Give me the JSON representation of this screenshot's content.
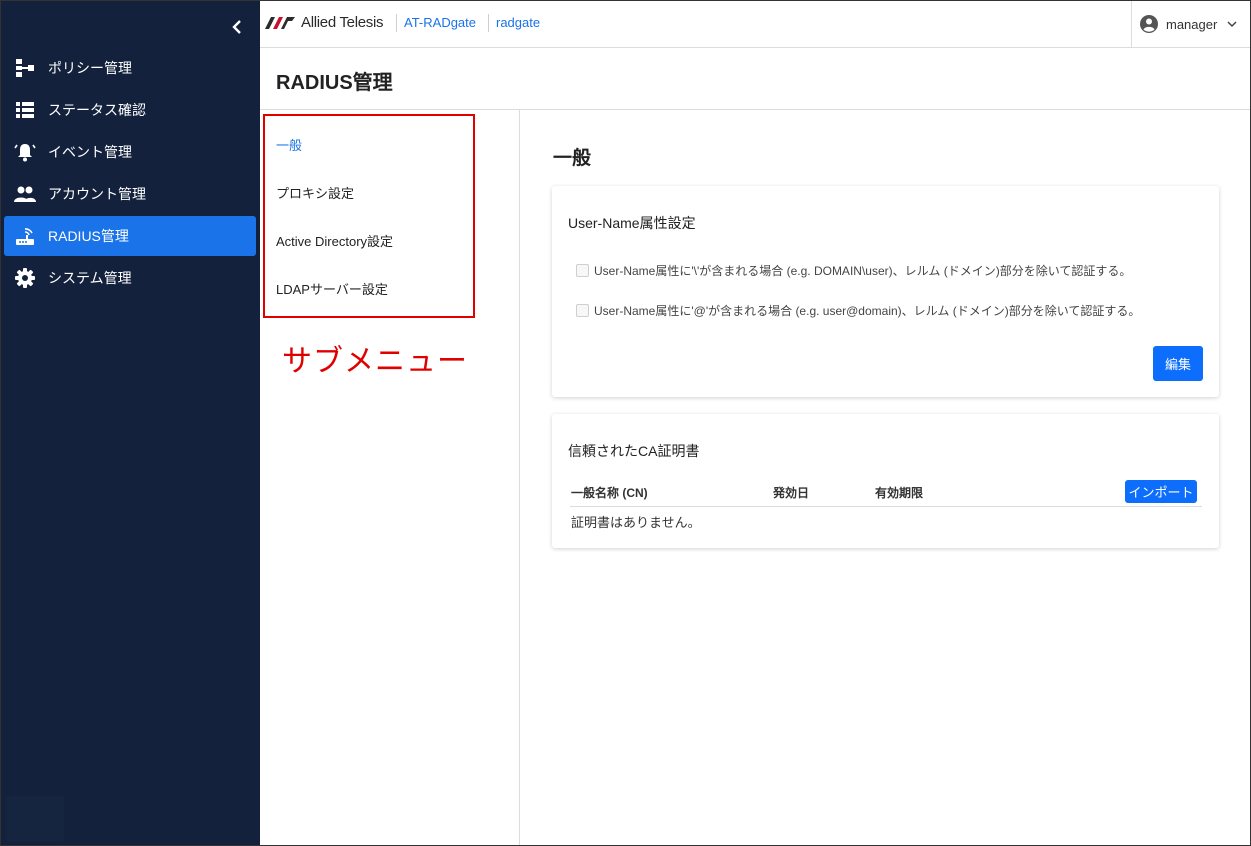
{
  "sidebar": {
    "items": [
      {
        "label": "ポリシー管理",
        "icon": "policy-tree-icon",
        "active": false
      },
      {
        "label": "ステータス確認",
        "icon": "list-icon",
        "active": false
      },
      {
        "label": "イベント管理",
        "icon": "alarm-bell-icon",
        "active": false
      },
      {
        "label": "アカウント管理",
        "icon": "people-icon",
        "active": false
      },
      {
        "label": "RADIUS管理",
        "icon": "router-icon",
        "active": true
      },
      {
        "label": "システム管理",
        "icon": "gear-icon",
        "active": false
      }
    ]
  },
  "header": {
    "logo_text": "Allied Telesis",
    "product": "AT-RADgate",
    "host": "radgate",
    "user": "manager"
  },
  "page": {
    "title": "RADIUS管理"
  },
  "submenu": {
    "items": [
      {
        "label": "一般",
        "active": true
      },
      {
        "label": "プロキシ設定",
        "active": false
      },
      {
        "label": "Active Directory設定",
        "active": false
      },
      {
        "label": "LDAPサーバー設定",
        "active": false
      }
    ],
    "annotation": "サブメニュー"
  },
  "content": {
    "section_title": "一般",
    "username_card": {
      "title": "User-Name属性設定",
      "options": [
        {
          "label": "User-Name属性に'\\'が含まれる場合 (e.g. DOMAIN\\user)、レルム (ドメイン)部分を除いて認証する。",
          "checked": false
        },
        {
          "label": "User-Name属性に'@'が含まれる場合 (e.g. user@domain)、レルム (ドメイン)部分を除いて認証する。",
          "checked": false
        }
      ],
      "edit_label": "編集"
    },
    "ca_card": {
      "title": "信頼されたCA証明書",
      "columns": [
        "一般名称 (CN)",
        "発効日",
        "有効期限"
      ],
      "import_label": "インポート",
      "empty_message": "証明書はありません。"
    }
  },
  "colors": {
    "sidebar_bg": "#13213c",
    "accent": "#1a73e8",
    "annotation": "#e00000"
  }
}
